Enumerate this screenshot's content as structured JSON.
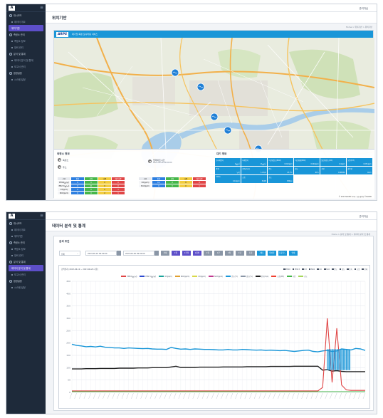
{
  "shot1": {
    "user": "관리자님",
    "menu": [
      {
        "label": "대시보드",
        "type": "section"
      },
      {
        "label": "데이터 개요",
        "type": "sub"
      },
      {
        "label": "위치기반",
        "type": "active"
      },
      {
        "label": "측정소 관리",
        "type": "section"
      },
      {
        "label": "측정소 정보",
        "type": "sub"
      },
      {
        "label": "장비 관리",
        "type": "sub"
      },
      {
        "label": "분석 및 통계",
        "type": "section"
      },
      {
        "label": "데이터 분석 및 통계",
        "type": "sub"
      },
      {
        "label": "보고서 관리",
        "type": "sub"
      },
      {
        "label": "환경설정",
        "type": "section"
      },
      {
        "label": "시스템 설정",
        "type": "sub"
      }
    ],
    "page_title": "위치기반",
    "breadcrumb": "Home > 위치기반 > 위치기반",
    "brand": "ARPS",
    "banner": "대기질 측정 모니터링 서비스",
    "stations_title": "측정소 정보",
    "stations": [
      "측정소",
      "주소"
    ],
    "selected_station": {
      "name": "업데이트시간",
      "time": "2023-06-26 09:00:00"
    },
    "table": {
      "headers": [
        "구분",
        "좋음",
        "보통",
        "나쁨",
        "매우나쁨"
      ],
      "rows": [
        {
          "label": "PM10(㎍/㎥)",
          "cells": [
            "9",
            "0",
            "0",
            "0"
          ]
        },
        {
          "label": "PM2.5(㎍/㎥)",
          "cells": [
            "0",
            "41",
            "0",
            "0"
          ]
        },
        {
          "label": "O3(ppm)",
          "cells": [
            "0",
            "0",
            "0",
            "1"
          ]
        },
        {
          "label": "NO2(ppm)",
          "cells": [
            "0",
            "0",
            "2",
            "1"
          ]
        }
      ]
    },
    "right_table": {
      "headers": [
        "구분",
        "좋음",
        "보통",
        "나쁨",
        "매우나쁨"
      ],
      "rows": [
        {
          "label": "CO(ppm)",
          "cells": [
            "0.1",
            "0",
            "8",
            "0"
          ]
        },
        {
          "label": "SO2(ppm)",
          "cells": [
            "0",
            "0",
            "0",
            "1"
          ]
        }
      ]
    },
    "air_title": "대기 정보",
    "tiles": [
      {
        "label": "초미세먼지",
        "value": "9㎍/㎥"
      },
      {
        "label": "미세먼지",
        "value": "11㎍/㎥"
      },
      {
        "label": "이산화질소(NO2)",
        "value": "0.012ppm"
      },
      {
        "label": "이산화황(SO2)",
        "value": "0.002ppm"
      },
      {
        "label": "일산화탄소(CO)",
        "value": "0.4ppm"
      },
      {
        "label": "오존(O3)",
        "value": "0.031ppm"
      },
      {
        "label": "풍향",
        "value": "남서"
      },
      {
        "label": "풍속(m/s)",
        "value": "1.2m/s"
      },
      {
        "label": "온도",
        "value": "23.1℃"
      },
      {
        "label": "습도",
        "value": "61%"
      },
      {
        "label": "기압",
        "value": "1008hPa"
      },
      {
        "label": "강수량",
        "value": "0mm"
      },
      {
        "label": "VOCs",
        "value": "0.12ppm"
      },
      {
        "label": "소음",
        "value": "52dB"
      },
      {
        "label": "조도",
        "value": "830lux"
      }
    ],
    "map_footer": "© 2023 NAVER Corp. 지도데이터 ©NAVER"
  },
  "shot2": {
    "user": "관리자님",
    "menu": [
      {
        "label": "대시보드",
        "type": "section"
      },
      {
        "label": "데이터 개요",
        "type": "sub"
      },
      {
        "label": "위치기반",
        "type": "sub"
      },
      {
        "label": "측정소 관리",
        "type": "section"
      },
      {
        "label": "측정소 정보",
        "type": "sub"
      },
      {
        "label": "장비 관리",
        "type": "sub"
      },
      {
        "label": "분석 및 통계",
        "type": "section"
      },
      {
        "label": "데이터 분석 및 통계",
        "type": "active"
      },
      {
        "label": "보고서 관리",
        "type": "sub"
      },
      {
        "label": "환경설정",
        "type": "section"
      },
      {
        "label": "시스템 설정",
        "type": "sub"
      }
    ],
    "page_title": "데이터 분석 및 통계",
    "breadcrumb": "Home > 분석 및 통계 > 데이터 분석 및 통계",
    "section_title": "검색 조건",
    "station_select": "전체",
    "date_from": "2023-06-19 09:00:00",
    "date_to": "2023-06-26 09:00:00",
    "period_buttons": [
      {
        "label": "전체",
        "color": "#8a96a6"
      },
      {
        "label": "1일",
        "color": "#5d4fc9"
      },
      {
        "label": "1주일",
        "color": "#5d4fc9"
      },
      {
        "label": "1개월",
        "color": "#5d4fc9"
      },
      {
        "label": "1일",
        "color": "#8a96a6"
      },
      {
        "label": "1주",
        "color": "#8a96a6"
      },
      {
        "label": "1월",
        "color": "#8a96a6"
      },
      {
        "label": "1년",
        "color": "#8a96a6"
      },
      {
        "label": "조회",
        "color": "#8a96a6"
      },
      {
        "label": "그래프",
        "color": "#1996d8"
      },
      {
        "label": "테이블",
        "color": "#1996d8"
      },
      {
        "label": "다운로드",
        "color": "#1996d8"
      },
      {
        "label": "인쇄",
        "color": "#1996d8"
      }
    ],
    "chart_caption": "검색결과 (2023-06-19 ~ 2023-06-26 기준)",
    "checkboxes": [
      "PM10",
      "PM2.5",
      "O3",
      "NO2",
      "CO",
      "SO2",
      "온도",
      "습도",
      "풍속",
      "소음",
      "전체"
    ]
  },
  "chart_data": {
    "type": "line",
    "title": "",
    "xlabel": "",
    "ylabel": "",
    "ylim": [
      0,
      450
    ],
    "y_ticks": [
      0,
      50,
      100,
      150,
      200,
      250,
      300,
      350,
      400,
      450
    ],
    "grid": true,
    "legend_position": "top-center",
    "legend": [
      {
        "name": "PM10(㎍/㎥)",
        "color": "#e04545"
      },
      {
        "name": "PM2.5(㎍/㎥)",
        "color": "#2d4bd0"
      },
      {
        "name": "O3(ppm)",
        "color": "#1aa39a"
      },
      {
        "name": "NO2(ppm)",
        "color": "#e0a030"
      },
      {
        "name": "CO(ppm)",
        "color": "#d9d94a"
      },
      {
        "name": "SO2(ppm)",
        "color": "#c03a90"
      },
      {
        "name": "온도(℃)",
        "color": "#1996d8"
      },
      {
        "name": "습도(%)",
        "color": "#8a96a6"
      },
      {
        "name": "풍속(m/s)",
        "color": "#222222"
      },
      {
        "name": "소음(dB)",
        "color": "#f04030"
      },
      {
        "name": "기압",
        "color": "#45b649"
      },
      {
        "name": "조도",
        "color": "#a5d65a"
      }
    ],
    "series": [
      {
        "name": "습도(%)",
        "color": "#1996d8",
        "values": [
          195,
          190,
          188,
          185,
          186,
          184,
          187,
          183,
          182,
          180,
          180,
          178,
          180,
          179,
          178,
          177,
          178,
          176,
          175,
          175,
          174,
          182,
          178,
          175,
          176,
          174,
          176,
          175,
          174,
          174,
          173,
          172,
          172,
          174,
          172,
          172,
          174,
          173,
          172,
          171,
          172,
          170,
          171,
          170,
          169,
          170,
          168,
          166,
          168,
          170,
          171,
          166,
          164,
          168,
          170,
          166,
          168,
          176,
          174,
          172,
          178,
          176,
          170
        ]
      },
      {
        "name": "온도(℃)",
        "color": "#222222",
        "values": [
          95,
          95,
          95,
          96,
          96,
          96,
          97,
          97,
          97,
          97,
          98,
          98,
          98,
          98,
          99,
          99,
          99,
          100,
          100,
          100,
          100,
          103,
          106,
          101,
          101,
          101,
          101,
          102,
          102,
          102,
          102,
          102,
          103,
          103,
          103,
          103,
          103,
          104,
          104,
          104,
          104,
          104,
          105,
          105,
          105,
          105,
          105,
          106,
          106,
          106,
          106,
          106,
          106,
          90,
          92,
          86,
          88,
          85,
          84,
          84,
          84,
          84,
          84
        ]
      },
      {
        "name": "PM10(㎍/㎥)",
        "color": "#e04545",
        "values": [
          6,
          6,
          6,
          6,
          6,
          6,
          6,
          6,
          6,
          6,
          6,
          6,
          6,
          6,
          6,
          6,
          6,
          6,
          6,
          6,
          6,
          6,
          6,
          6,
          6,
          6,
          6,
          6,
          6,
          6,
          6,
          6,
          6,
          6,
          6,
          6,
          6,
          6,
          6,
          6,
          6,
          6,
          6,
          6,
          6,
          6,
          6,
          6,
          6,
          6,
          6,
          6,
          6,
          20,
          300,
          40,
          260,
          30,
          10,
          8,
          8,
          8,
          8
        ]
      },
      {
        "name": "PM2.5(㎍/㎥)",
        "color": "#45b649",
        "values": [
          3,
          3,
          3,
          3,
          3,
          3,
          3,
          3,
          3,
          3,
          3,
          3,
          3,
          3,
          3,
          3,
          3,
          3,
          3,
          3,
          3,
          3,
          3,
          3,
          3,
          3,
          3,
          3,
          3,
          3,
          3,
          3,
          3,
          3,
          3,
          3,
          3,
          3,
          3,
          3,
          3,
          3,
          3,
          3,
          3,
          3,
          3,
          3,
          3,
          3,
          3,
          3,
          3,
          3,
          3,
          3,
          3,
          3,
          3,
          3,
          3,
          3,
          3
        ]
      }
    ]
  }
}
